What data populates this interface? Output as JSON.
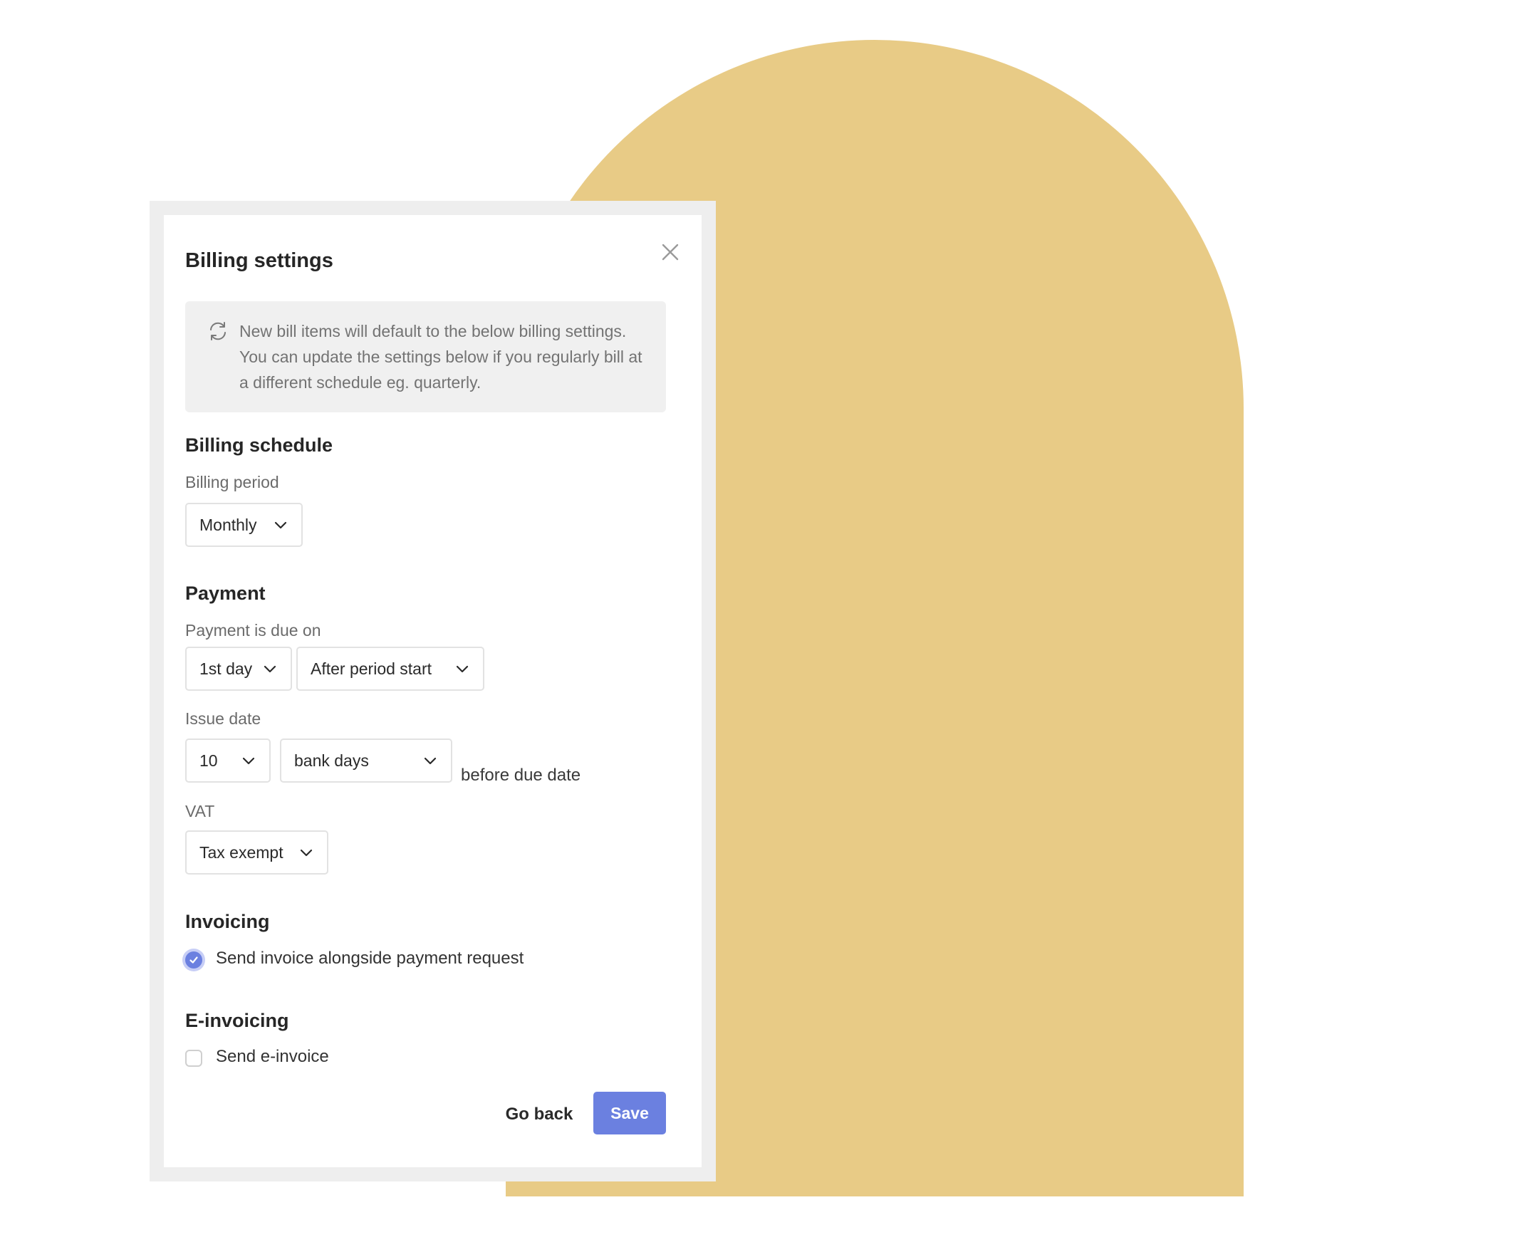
{
  "dialog": {
    "title": "Billing settings",
    "close_icon": "close-icon",
    "info": {
      "icon": "refresh-icon",
      "text": "New bill items will default to the below billing settings. You can update the settings below if you regularly bill at a different schedule eg. quarterly."
    }
  },
  "billing_schedule": {
    "heading": "Billing schedule",
    "period_label": "Billing period",
    "period_value": "Monthly"
  },
  "payment": {
    "heading": "Payment",
    "due_label": "Payment is due on",
    "due_day": "1st day",
    "due_relative": "After period start",
    "issue_label": "Issue date",
    "issue_count": "10",
    "issue_unit": "bank days",
    "issue_suffix": "before due date",
    "vat_label": "VAT",
    "vat_value": "Tax exempt"
  },
  "invoicing": {
    "heading": "Invoicing",
    "checkbox_label": "Send invoice alongside payment request",
    "checked": true
  },
  "einvoicing": {
    "heading": "E-invoicing",
    "checkbox_label": "Send e-invoice",
    "checked": false
  },
  "actions": {
    "back_label": "Go back",
    "save_label": "Save"
  },
  "colors": {
    "accent": "#6b80e0",
    "arch": "#e8cb86",
    "frame": "#eeeeee"
  },
  "icons": {
    "chevron": "chevron-down-icon",
    "check": "check-icon"
  }
}
